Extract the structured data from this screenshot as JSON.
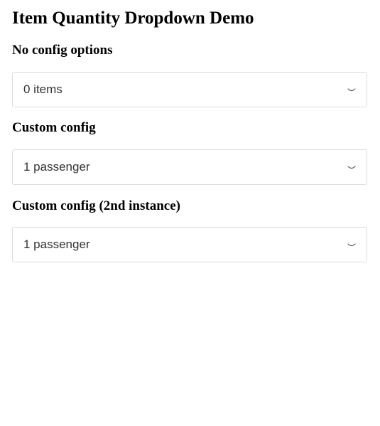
{
  "page": {
    "title": "Item Quantity Dropdown Demo"
  },
  "sections": [
    {
      "heading": "No config options",
      "dropdown": {
        "value": "0 items",
        "icon": "chevron-down-icon"
      }
    },
    {
      "heading": "Custom config",
      "dropdown": {
        "value": "1 passenger",
        "icon": "chevron-down-icon"
      }
    },
    {
      "heading": "Custom config (2nd instance)",
      "dropdown": {
        "value": "1 passenger",
        "icon": "chevron-down-icon"
      }
    }
  ],
  "colors": {
    "border": "#dcdcdc",
    "value_text": "#333333",
    "chevron": "#555555"
  }
}
